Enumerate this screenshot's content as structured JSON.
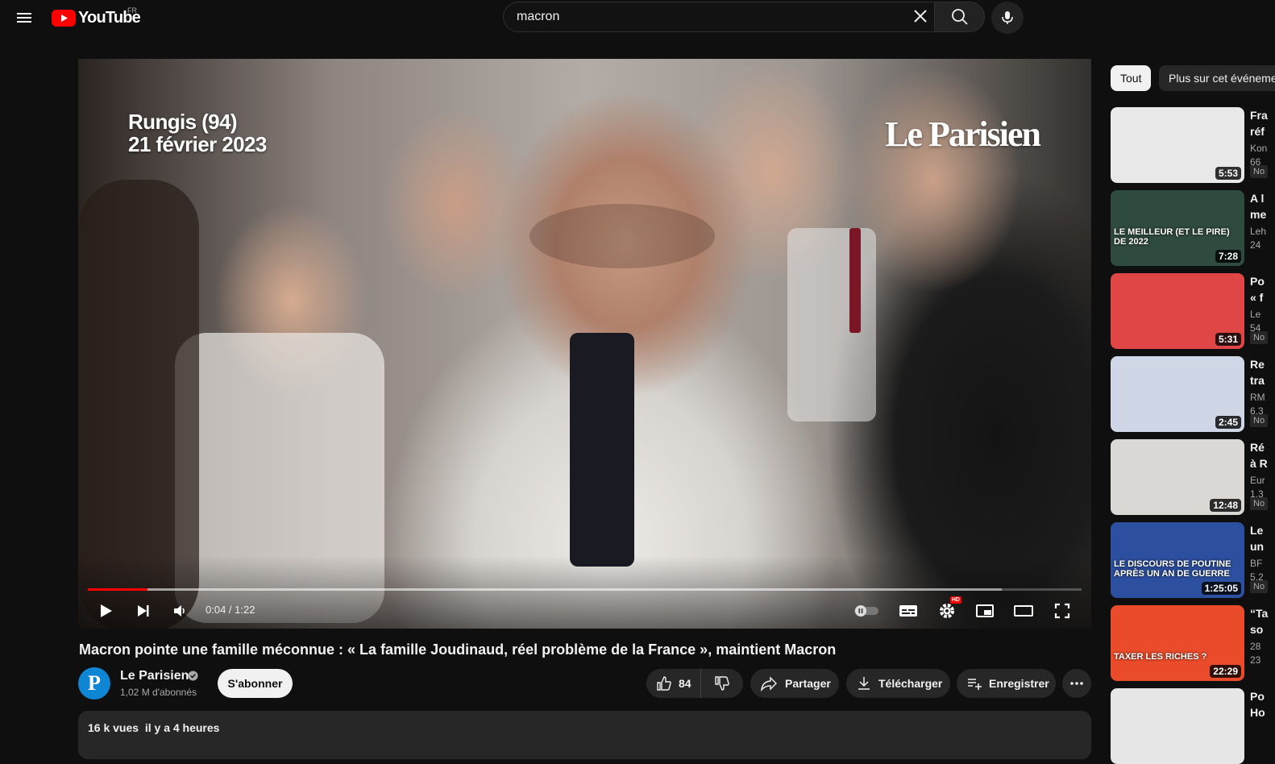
{
  "masthead": {
    "logo_text": "YouTube",
    "region": "FR",
    "search_value": "macron",
    "icons": [
      "menu-icon",
      "youtube-logo-icon",
      "close-icon",
      "search-icon",
      "mic-icon"
    ]
  },
  "player": {
    "overlay_location": "Rungis (94)",
    "overlay_date": "21 février 2023",
    "overlay_brand": "Le Parisien",
    "time": "0:04 / 1:22",
    "progress_played": 0.06,
    "progress_loaded": 0.92,
    "hd_label": "HD",
    "accent_color": "#ff0000"
  },
  "video": {
    "title": "Macron pointe une famille méconnue : « La famille Joudinaud, réel problème de la France », maintient Macron",
    "channel_initial": "P",
    "channel_name": "Le Parisien",
    "subscribers": "1,02 M d'abonnés",
    "subscribe_label": "S'abonner",
    "like_count": "84",
    "share_label": "Partager",
    "download_label": "Télécharger",
    "save_label": "Enregistrer",
    "views": "16 k vues",
    "date": "il y a 4 heures"
  },
  "sidebar": {
    "chips": [
      "Tout",
      "Plus sur cet événement"
    ],
    "recommendations": [
      {
        "title": "Fra",
        "title2": "réf",
        "meta1": "Kon",
        "meta2": "66",
        "badge": "No",
        "duration": "5:53",
        "bg": "#e8e8e8",
        "caption": ""
      },
      {
        "title": "A l",
        "title2": "me",
        "meta1": "Leh",
        "meta2": "24",
        "badge": "",
        "duration": "7:28",
        "bg": "#2f4a3e",
        "caption": "LE MEILLEUR (ET LE PIRE) DE 2022"
      },
      {
        "title": "Po",
        "title2": "« f",
        "meta1": "Le",
        "meta2": "54",
        "badge": "No",
        "duration": "5:31",
        "bg": "#e04646",
        "caption": ""
      },
      {
        "title": "Re",
        "title2": "tra",
        "meta1": "RM",
        "meta2": "6,3",
        "badge": "No",
        "duration": "2:45",
        "bg": "#cfd6e6",
        "caption": ""
      },
      {
        "title": "Ré",
        "title2": "à R",
        "meta1": "Eur",
        "meta2": "1,3",
        "badge": "No",
        "duration": "12:48",
        "bg": "#dad8d4",
        "caption": ""
      },
      {
        "title": "Le",
        "title2": "un",
        "meta1": "BF",
        "meta2": "5,2",
        "badge": "No",
        "duration": "1:25:05",
        "bg": "#2d4fa0",
        "caption": "LE DISCOURS DE POUTINE APRÈS UN AN DE GUERRE"
      },
      {
        "title": "“Ta",
        "title2": "so",
        "meta1": "28",
        "meta2": "23",
        "badge": "",
        "duration": "22:29",
        "bg": "#ea4b2a",
        "caption": "TAXER LES RICHES ?"
      },
      {
        "title": "Po",
        "title2": "Ho",
        "meta1": "",
        "meta2": "",
        "badge": "",
        "duration": "",
        "bg": "#e6e6e6",
        "caption": ""
      }
    ]
  }
}
